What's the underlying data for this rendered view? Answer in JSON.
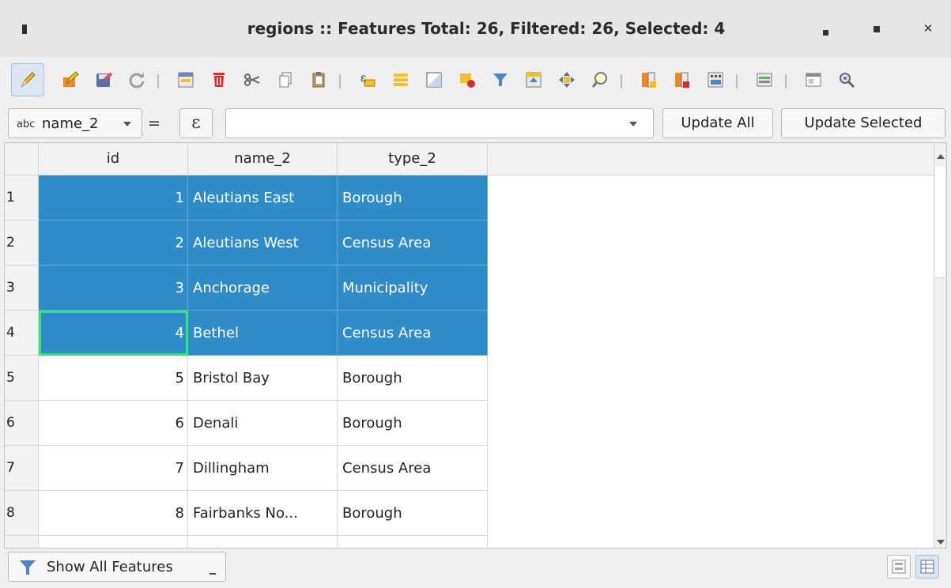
{
  "window": {
    "title": "regions :: Features Total: 26, Filtered: 26, Selected: 4"
  },
  "toolbar": {
    "icons": [
      "toggle-editing-icon",
      "multi-edit-icon",
      "save-edits-icon",
      "reload-icon",
      "add-feature-icon",
      "delete-feature-icon",
      "cut-icon",
      "copy-icon",
      "paste-icon",
      "select-by-expression-icon",
      "select-all-icon",
      "invert-selection-icon",
      "deselect-all-icon",
      "filter-select-icon",
      "move-selection-to-top-icon",
      "pan-to-selected-icon",
      "zoom-to-selected-icon",
      "new-field-icon",
      "delete-field-icon",
      "field-calculator-icon",
      "conditional-formatting-icon",
      "dock-table-icon",
      "actions-icon"
    ]
  },
  "calc": {
    "field_type_badge": "abc",
    "field": "name_2",
    "equals": "=",
    "expression_symbol": "ε",
    "expression_value": "",
    "update_all": "Update All",
    "update_selected": "Update Selected"
  },
  "table": {
    "columns": [
      "id",
      "name_2",
      "type_2"
    ],
    "rows": [
      {
        "rownum": "1",
        "id": "1",
        "name_2": "Aleutians East",
        "type_2": "Borough",
        "selected": true
      },
      {
        "rownum": "2",
        "id": "2",
        "name_2": "Aleutians West",
        "type_2": "Census Area",
        "selected": true
      },
      {
        "rownum": "3",
        "id": "3",
        "name_2": "Anchorage",
        "type_2": "Municipality",
        "selected": true
      },
      {
        "rownum": "4",
        "id": "4",
        "name_2": "Bethel",
        "type_2": "Census Area",
        "selected": true
      },
      {
        "rownum": "5",
        "id": "5",
        "name_2": "Bristol Bay",
        "type_2": "Borough",
        "selected": false
      },
      {
        "rownum": "6",
        "id": "6",
        "name_2": "Denali",
        "type_2": "Borough",
        "selected": false
      },
      {
        "rownum": "7",
        "id": "7",
        "name_2": "Dillingham",
        "type_2": "Census Area",
        "selected": false
      },
      {
        "rownum": "8",
        "id": "8",
        "name_2": "Fairbanks No...",
        "type_2": "Borough",
        "selected": false
      },
      {
        "rownum": "",
        "id": "",
        "name_2": "",
        "type_2": "",
        "selected": false
      }
    ],
    "current_cell": {
      "row": 3,
      "column": "id"
    },
    "selection_color": "#308cc6",
    "current_cell_border_color": "#2ee57a"
  },
  "bottom": {
    "filter_button": "Show All Features",
    "view_buttons": [
      "form-view-icon",
      "table-view-icon"
    ]
  }
}
